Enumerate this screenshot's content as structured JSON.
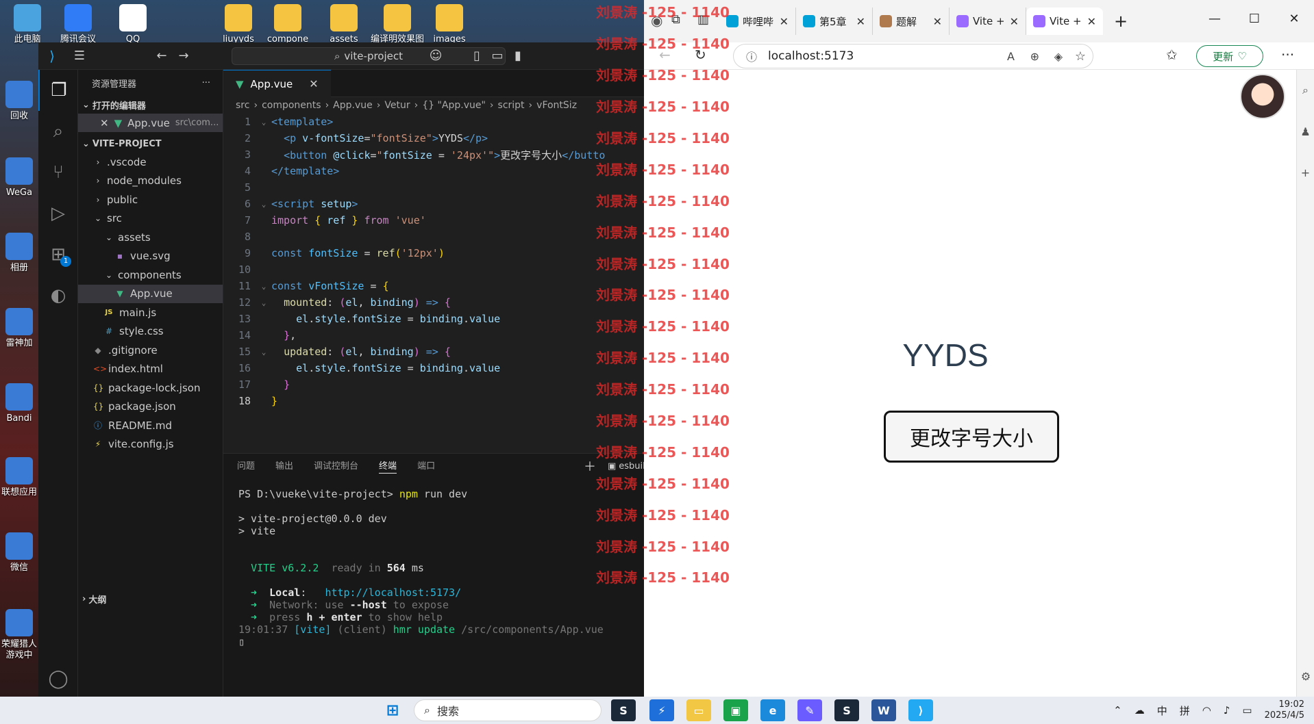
{
  "desktop": {
    "top_icons": [
      {
        "label": "此电脑",
        "icon": "computer-icon",
        "color": "#4aa3df"
      },
      {
        "label": "腾讯会议",
        "icon": "tencent-meeting-icon",
        "color": "#2f7cf6"
      },
      {
        "label": "QQ",
        "icon": "qq-icon",
        "color": "#ffffff"
      },
      {
        "label": "liuyyds",
        "icon": "folder-icon",
        "color": "#f5c542"
      },
      {
        "label": "compone",
        "icon": "folder-icon",
        "color": "#f5c542"
      },
      {
        "label": "assets",
        "icon": "folder-icon",
        "color": "#f5c542"
      },
      {
        "label": "编译明效果图",
        "icon": "folder-icon",
        "color": "#f5c542"
      },
      {
        "label": "images",
        "icon": "folder-icon",
        "color": "#f5c542"
      }
    ],
    "left_icons": [
      {
        "label": "回收",
        "icon": "recycle-bin-icon"
      },
      {
        "label": "WeGa",
        "icon": "wegame-icon"
      },
      {
        "label": "相册",
        "icon": "photos-icon"
      },
      {
        "label": "雷神加",
        "icon": "leishen-icon"
      },
      {
        "label": "Bandi",
        "icon": "bandizip-icon"
      },
      {
        "label": "联想应用",
        "icon": "lenovo-app-icon"
      },
      {
        "label": "微信",
        "icon": "wechat-icon"
      },
      {
        "label": "荣耀猎人游戏中",
        "icon": "honor-game-icon"
      }
    ]
  },
  "vscode": {
    "search_text": "vite-project",
    "sidebar": {
      "title": "资源管理器",
      "more": "···",
      "open_editors_label": "打开的编辑器",
      "open_editor": {
        "name": "App.vue",
        "path": "src\\com..."
      },
      "project_label": "VITE-PROJECT",
      "tree": [
        {
          "label": ".vscode",
          "indent": 1,
          "kind": "folder",
          "twisty": "›"
        },
        {
          "label": "node_modules",
          "indent": 1,
          "kind": "folder",
          "twisty": "›"
        },
        {
          "label": "public",
          "indent": 1,
          "kind": "folder",
          "twisty": "›"
        },
        {
          "label": "src",
          "indent": 1,
          "kind": "folder-open",
          "twisty": "⌄"
        },
        {
          "label": "assets",
          "indent": 2,
          "kind": "folder-open",
          "twisty": "⌄"
        },
        {
          "label": "vue.svg",
          "indent": 3,
          "kind": "svg"
        },
        {
          "label": "components",
          "indent": 2,
          "kind": "folder-open",
          "twisty": "⌄"
        },
        {
          "label": "App.vue",
          "indent": 3,
          "kind": "vue",
          "selected": true
        },
        {
          "label": "main.js",
          "indent": 2,
          "kind": "js"
        },
        {
          "label": "style.css",
          "indent": 2,
          "kind": "css"
        },
        {
          "label": ".gitignore",
          "indent": 1,
          "kind": "git"
        },
        {
          "label": "index.html",
          "indent": 1,
          "kind": "html"
        },
        {
          "label": "package-lock.json",
          "indent": 1,
          "kind": "json"
        },
        {
          "label": "package.json",
          "indent": 1,
          "kind": "json"
        },
        {
          "label": "README.md",
          "indent": 1,
          "kind": "md"
        },
        {
          "label": "vite.config.js",
          "indent": 1,
          "kind": "vite"
        }
      ],
      "outline_label": "大纲"
    },
    "tab": {
      "label": "App.vue",
      "close": "✕"
    },
    "breadcrumb": [
      "src",
      "components",
      "App.vue",
      "Vetur",
      "{} \"App.vue\"",
      "script",
      "vFontSiz"
    ],
    "code_lines": [
      {
        "n": "1",
        "fold": "⌄",
        "tokens": [
          [
            "k-tag",
            "<template>"
          ]
        ]
      },
      {
        "n": "2",
        "fold": "",
        "tokens": [
          [
            "k-txt",
            "  "
          ],
          [
            "k-tag",
            "<p "
          ],
          [
            "k-attr",
            "v-fontSize"
          ],
          [
            "k-txt",
            "="
          ],
          [
            "k-str",
            "\"fontSize\""
          ],
          [
            "k-tag",
            ">"
          ],
          [
            "k-txt",
            "YYDS"
          ],
          [
            "k-tag",
            "</p>"
          ]
        ]
      },
      {
        "n": "3",
        "fold": "",
        "tokens": [
          [
            "k-txt",
            "  "
          ],
          [
            "k-tag",
            "<button "
          ],
          [
            "k-attr",
            "@click"
          ],
          [
            "k-txt",
            "="
          ],
          [
            "k-str",
            "\""
          ],
          [
            "k-prop",
            "fontSize"
          ],
          [
            "k-txt",
            " = "
          ],
          [
            "k-str",
            "'24px'"
          ],
          [
            "k-str",
            "\""
          ],
          [
            "k-tag",
            ">"
          ],
          [
            "k-txt",
            "更改字号大小"
          ],
          [
            "k-tag",
            "</butto"
          ]
        ]
      },
      {
        "n": "4",
        "fold": "",
        "tokens": [
          [
            "k-tag",
            "</template>"
          ]
        ]
      },
      {
        "n": "5",
        "fold": "",
        "tokens": []
      },
      {
        "n": "6",
        "fold": "⌄",
        "tokens": [
          [
            "k-tag",
            "<script "
          ],
          [
            "k-attr",
            "setup"
          ],
          [
            "k-tag",
            ">"
          ]
        ]
      },
      {
        "n": "7",
        "fold": "",
        "tokens": [
          [
            "k-kw2",
            "import "
          ],
          [
            "k-br",
            "{ "
          ],
          [
            "k-prop",
            "ref"
          ],
          [
            "k-br",
            " }"
          ],
          [
            "k-kw2",
            " from "
          ],
          [
            "k-str",
            "'vue'"
          ]
        ]
      },
      {
        "n": "8",
        "fold": "",
        "tokens": []
      },
      {
        "n": "9",
        "fold": "",
        "tokens": [
          [
            "k-kw",
            "const "
          ],
          [
            "k-var",
            "fontSize"
          ],
          [
            "k-txt",
            " = "
          ],
          [
            "k-fn",
            "ref"
          ],
          [
            "k-br",
            "("
          ],
          [
            "k-str",
            "'12px'"
          ],
          [
            "k-br",
            ")"
          ]
        ]
      },
      {
        "n": "10",
        "fold": "",
        "tokens": []
      },
      {
        "n": "11",
        "fold": "⌄",
        "tokens": [
          [
            "k-kw",
            "const "
          ],
          [
            "k-var",
            "vFontSize"
          ],
          [
            "k-txt",
            " = "
          ],
          [
            "k-br",
            "{"
          ]
        ]
      },
      {
        "n": "12",
        "fold": "⌄",
        "tokens": [
          [
            "k-txt",
            "  "
          ],
          [
            "k-fn",
            "mounted"
          ],
          [
            "k-txt",
            ": "
          ],
          [
            "k-br2",
            "("
          ],
          [
            "k-prop",
            "el"
          ],
          [
            "k-txt",
            ", "
          ],
          [
            "k-prop",
            "binding"
          ],
          [
            "k-br2",
            ")"
          ],
          [
            "k-kw",
            " => "
          ],
          [
            "k-br2",
            "{"
          ]
        ]
      },
      {
        "n": "13",
        "fold": "",
        "tokens": [
          [
            "k-txt",
            "    "
          ],
          [
            "k-prop",
            "el"
          ],
          [
            "k-txt",
            "."
          ],
          [
            "k-prop",
            "style"
          ],
          [
            "k-txt",
            "."
          ],
          [
            "k-prop",
            "fontSize"
          ],
          [
            "k-txt",
            " = "
          ],
          [
            "k-prop",
            "binding"
          ],
          [
            "k-txt",
            "."
          ],
          [
            "k-prop",
            "value"
          ]
        ]
      },
      {
        "n": "14",
        "fold": "",
        "tokens": [
          [
            "k-txt",
            "  "
          ],
          [
            "k-br2",
            "}"
          ],
          [
            "k-txt",
            ","
          ]
        ]
      },
      {
        "n": "15",
        "fold": "⌄",
        "tokens": [
          [
            "k-txt",
            "  "
          ],
          [
            "k-fn",
            "updated"
          ],
          [
            "k-txt",
            ": "
          ],
          [
            "k-br2",
            "("
          ],
          [
            "k-prop",
            "el"
          ],
          [
            "k-txt",
            ", "
          ],
          [
            "k-prop",
            "binding"
          ],
          [
            "k-br2",
            ")"
          ],
          [
            "k-kw",
            " => "
          ],
          [
            "k-br2",
            "{"
          ]
        ]
      },
      {
        "n": "16",
        "fold": "",
        "tokens": [
          [
            "k-txt",
            "    "
          ],
          [
            "k-prop",
            "el"
          ],
          [
            "k-txt",
            "."
          ],
          [
            "k-prop",
            "style"
          ],
          [
            "k-txt",
            "."
          ],
          [
            "k-prop",
            "fontSize"
          ],
          [
            "k-txt",
            " = "
          ],
          [
            "k-prop",
            "binding"
          ],
          [
            "k-txt",
            "."
          ],
          [
            "k-prop",
            "value"
          ]
        ]
      },
      {
        "n": "17",
        "fold": "",
        "tokens": [
          [
            "k-txt",
            "  "
          ],
          [
            "k-br2",
            "}"
          ]
        ]
      },
      {
        "n": "18",
        "fold": "",
        "tokens": [
          [
            "k-br",
            "}"
          ]
        ],
        "current": true
      }
    ],
    "panel": {
      "tabs": [
        "问题",
        "输出",
        "调试控制台",
        "终端",
        "端口"
      ],
      "active_tab": "终端",
      "terminal_name": "esbuild",
      "terminal_lines": [
        {
          "parts": [
            [
              "",
              "PS D:\\vueke\\vite-project> "
            ],
            [
              "t-yellow",
              "npm"
            ],
            [
              "",
              " run dev"
            ]
          ]
        },
        {
          "parts": [
            [
              "",
              ""
            ]
          ]
        },
        {
          "parts": [
            [
              "",
              "> vite-project@0.0.0 dev"
            ]
          ]
        },
        {
          "parts": [
            [
              "",
              "> vite"
            ]
          ]
        },
        {
          "parts": [
            [
              "",
              ""
            ]
          ]
        },
        {
          "parts": [
            [
              "",
              ""
            ]
          ]
        },
        {
          "parts": [
            [
              "",
              "  "
            ],
            [
              "t-green",
              "VITE v6.2.2"
            ],
            [
              "t-dim",
              "  ready in "
            ],
            [
              "t-bold",
              "564"
            ],
            [
              "",
              " ms"
            ]
          ]
        },
        {
          "parts": [
            [
              "",
              ""
            ]
          ]
        },
        {
          "parts": [
            [
              "t-green",
              "  ➜  "
            ],
            [
              "t-bold",
              "Local"
            ],
            [
              "",
              ":   "
            ],
            [
              "t-cyan",
              "http://localhost:5173/"
            ]
          ]
        },
        {
          "parts": [
            [
              "t-green",
              "  ➜  "
            ],
            [
              "t-dim",
              "Network: use "
            ],
            [
              "t-bold",
              "--host"
            ],
            [
              "t-dim",
              " to expose"
            ]
          ]
        },
        {
          "parts": [
            [
              "t-green",
              "  ➜  "
            ],
            [
              "t-dim",
              "press "
            ],
            [
              "t-bold",
              "h + enter"
            ],
            [
              "t-dim",
              " to show help"
            ]
          ]
        },
        {
          "parts": [
            [
              "t-dim",
              "19:01:37 "
            ],
            [
              "t-cyan",
              "[vite]"
            ],
            [
              "t-dim",
              " (client) "
            ],
            [
              "t-green",
              "hmr update "
            ],
            [
              "t-dim",
              "/src/components/App.vue"
            ]
          ]
        }
      ]
    }
  },
  "browser": {
    "tabs": [
      {
        "label": "哔哩哔",
        "fav": "bilibili-icon",
        "fav_color": "#00a1d6"
      },
      {
        "label": "第5章",
        "fav": "bilibili-icon",
        "fav_color": "#00a1d6"
      },
      {
        "label": "题解",
        "fav": "leetcode-icon",
        "fav_color": "#b07a4f"
      },
      {
        "label": "Vite + ",
        "fav": "vite-icon",
        "fav_color": "#9b6bff"
      },
      {
        "label": "Vite + ",
        "fav": "vite-icon",
        "fav_color": "#9b6bff",
        "active": true
      }
    ],
    "url": "localhost:5173",
    "update_label": "更新",
    "page": {
      "heading": "YYDS",
      "button_label": "更改字号大小"
    }
  },
  "watermark": {
    "text": "刘景涛 -125 - 1140",
    "repeat": 19
  },
  "taskbar": {
    "search_placeholder": "搜索",
    "tray": {
      "ime_lang": "中",
      "ime_mode": "拼",
      "time": "19:02",
      "date": "2025/4/5"
    }
  }
}
